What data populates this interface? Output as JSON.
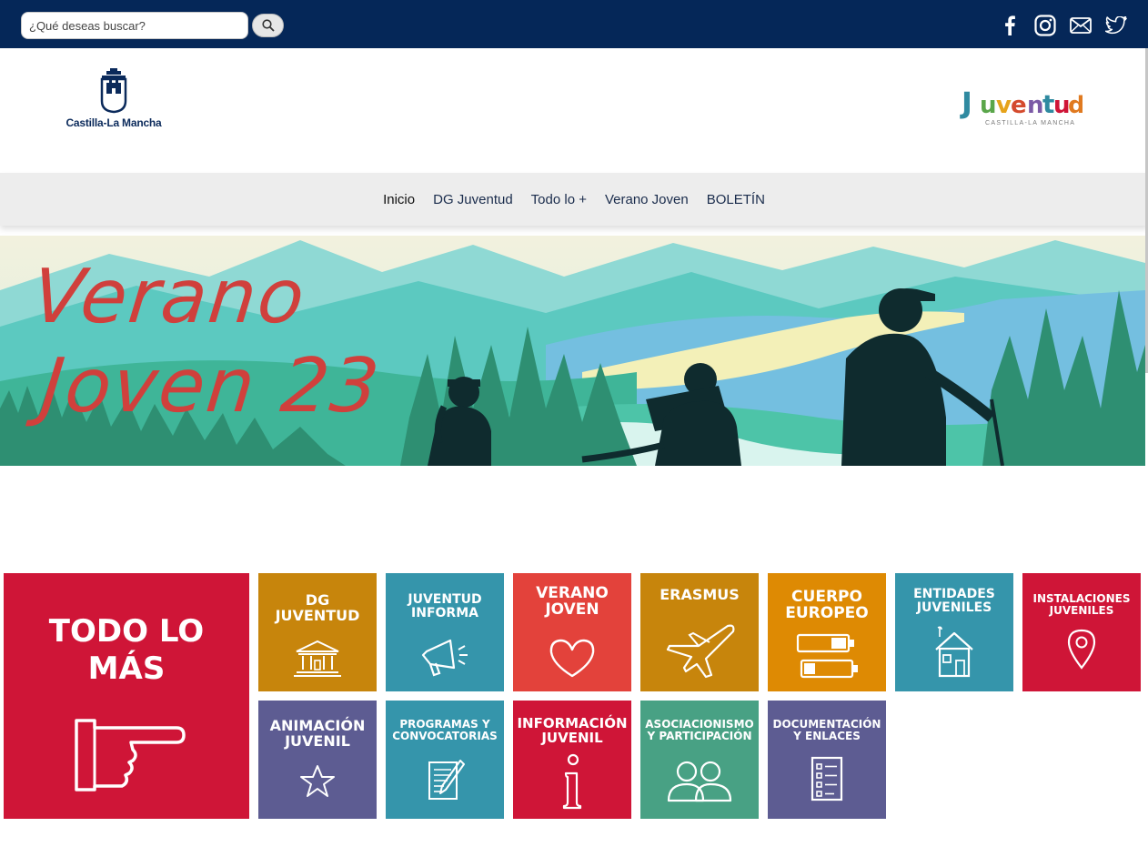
{
  "search": {
    "placeholder": "¿Qué deseas buscar?"
  },
  "social": {
    "facebook": "facebook-icon",
    "instagram": "instagram-icon",
    "email": "mail-icon",
    "twitter": "twitter-icon"
  },
  "header": {
    "left_logo_text": "Castilla-La Mancha",
    "right_logo_title": "Juventud",
    "right_logo_sub": "CASTILLA-LA MANCHA"
  },
  "nav": {
    "items": [
      {
        "label": "Inicio"
      },
      {
        "label": "DG Juventud"
      },
      {
        "label": "Todo lo +"
      },
      {
        "label": "Verano Joven"
      },
      {
        "label": "BOLETÍN"
      }
    ]
  },
  "hero": {
    "line1": "Verano",
    "line2": "Joven 23"
  },
  "colors": {
    "topbar": "#052758",
    "red": "#cf1537",
    "ochre": "#c7850c",
    "teal": "#3595ab",
    "coral": "#e3423b",
    "orange": "#de8a03",
    "purple": "#5d5c92",
    "green": "#48a184"
  },
  "tiles": {
    "big": {
      "line1": "TODO LO",
      "line2": "MÁS"
    },
    "dg_juventud": {
      "line1": "DG",
      "line2": "JUVENTUD"
    },
    "juventud_informa": {
      "line1": "JUVENTUD",
      "line2": "INFORMA"
    },
    "verano_joven": {
      "line1": "VERANO",
      "line2": "JOVEN"
    },
    "erasmus": {
      "line1": "ERASMUS"
    },
    "cuerpo_europeo": {
      "line1": "CUERPO",
      "line2": "EUROPEO"
    },
    "entidades_juveniles": {
      "line1": "ENTIDADES",
      "line2": "JUVENILES"
    },
    "instalaciones_juveniles": {
      "line1": "INSTALACIONES",
      "line2": "JUVENILES"
    },
    "animacion_juvenil": {
      "line1": "ANIMACIÓN",
      "line2": "JUVENIL"
    },
    "programas": {
      "line1": "PROGRAMAS Y",
      "line2": "CONVOCATORIAS"
    },
    "informacion_juvenil": {
      "line1": "INFORMACIÓN",
      "line2": "JUVENIL"
    },
    "asociacionismo": {
      "line1": "ASOCIACIONISMO",
      "line2": "Y PARTICIPACIÓN"
    },
    "documentacion": {
      "line1": "DOCUMENTACIÓN",
      "line2": "Y ENLACES"
    }
  }
}
